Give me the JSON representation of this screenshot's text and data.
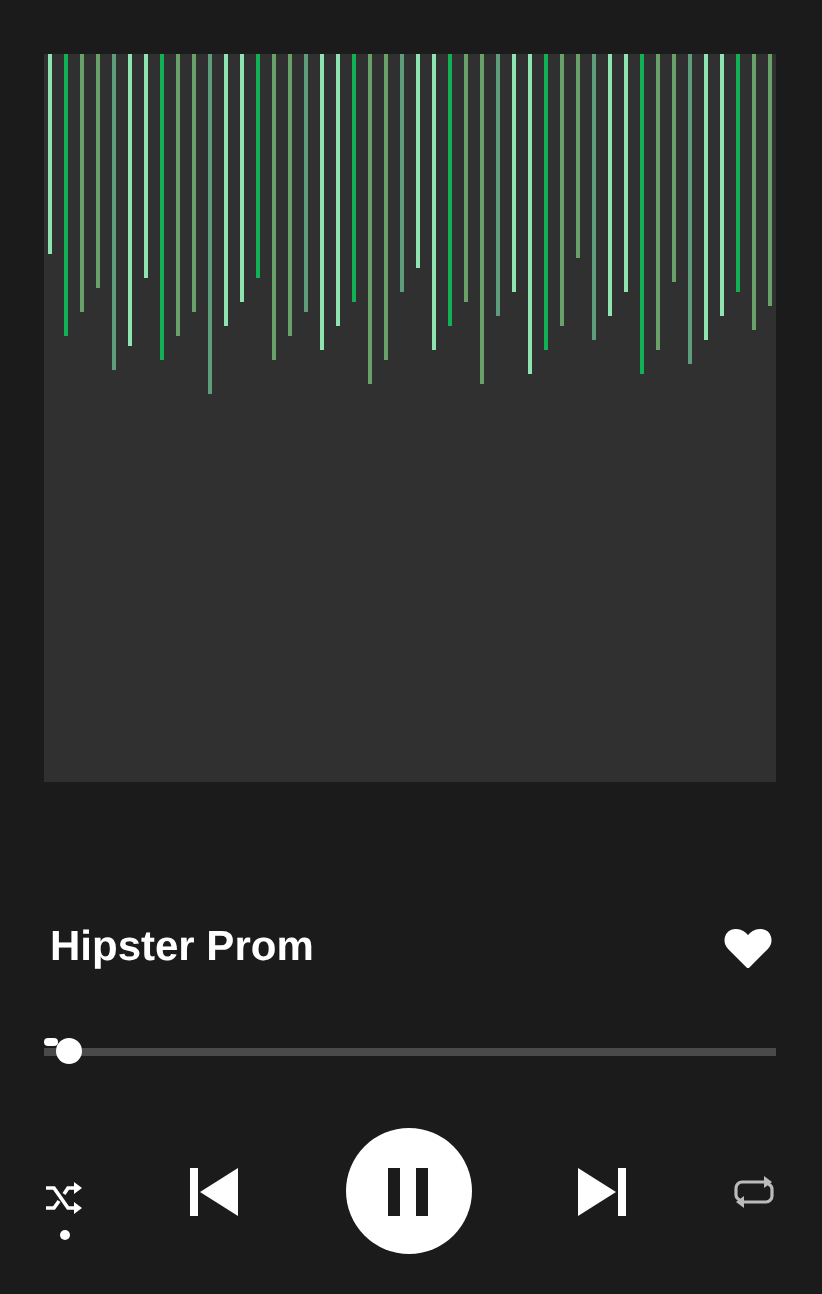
{
  "track": {
    "title": "Hipster Prom",
    "liked": true
  },
  "progress": {
    "level": 0.02
  },
  "controls": {
    "shuffle_on": true,
    "repeat_on": false,
    "playing": true
  }
}
